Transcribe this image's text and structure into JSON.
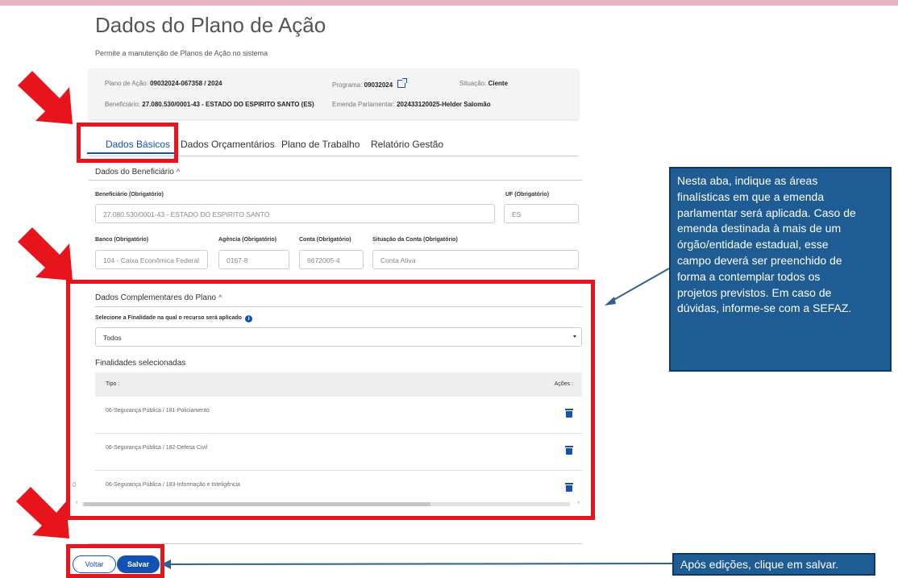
{
  "page": {
    "title": "Dados do Plano de Ação",
    "subtitle": "Permite a manutenção de Planos de Ação no sistema"
  },
  "info": {
    "plano_label": "Plano de Ação:",
    "plano_value": "09032024-067358 / 2024",
    "programa_label": "Programa:",
    "programa_value": "09032024",
    "situacao_label": "Situação:",
    "situacao_value": "Ciente",
    "beneficiario_label": "Beneficiário:",
    "beneficiario_value": "27.080.530/0001-43 - ESTADO DO ESPIRITO SANTO (ES)",
    "emenda_label": "Emenda Parlamentar:",
    "emenda_value": "202433120025-Helder Salomão"
  },
  "tabs": [
    {
      "label": "Dados Básicos",
      "active": true
    },
    {
      "label": "Dados Orçamentários",
      "active": false
    },
    {
      "label": "Plano de Trabalho",
      "active": false
    },
    {
      "label": "Relatório Gestão",
      "active": false
    }
  ],
  "beneficiario_section": {
    "title": "Dados do Beneficiário",
    "beneficiario_label": "Beneficiário (Obrigatório)",
    "beneficiario_value": "27.080.530/0001-43 - ESTADO DO ESPIRITO SANTO",
    "uf_label": "UF (Obrigatório)",
    "uf_value": "ES",
    "banco_label": "Banco (Obrigatório)",
    "banco_value": "104 - Caixa Econômica Federal",
    "agencia_label": "Agência (Obrigatório)",
    "agencia_value": "0167-8",
    "conta_label": "Conta (Obrigatório)",
    "conta_value": "6672005-4",
    "situacao_label": "Situação da Conta (Obrigatório)",
    "situacao_value": "Conta Ativa"
  },
  "complementares": {
    "title": "Dados Complementares do Plano",
    "select_label": "Selecione a Finalidade na qual o recurso será aplicado",
    "select_value": "Todos",
    "finalidades_title": "Finalidades selecionadas",
    "col_tipo": "Tipo :",
    "col_acoes": "Ações :",
    "rows": [
      "06-Segurança Pública / 181-Policiamento",
      "06-Segurança Pública / 182-Defesa Civil",
      "06-Segurança Pública / 183-Informação e Inteligência"
    ]
  },
  "buttons": {
    "voltar": "Voltar",
    "salvar": "Salvar"
  },
  "callouts": {
    "abas": [
      "Nesta aba, indique as áreas",
      "finalísticas em que a emenda",
      "parlamentar será aplicada. Caso de",
      "emenda destinada à mais de um",
      "órgão/entidade estadual, esse",
      "campo deverá ser preenchido de",
      "forma a contemplar todos os",
      "projetos previstos. Em caso de",
      "dúvidas, informe-se com a SEFAZ."
    ],
    "salvar": "Após edições, clique em salvar."
  },
  "misc": {
    "row_marker": "0"
  },
  "colors": {
    "primary": "#1351b4",
    "highlight_red": "#e8141b",
    "callout_bg": "#1f5c93",
    "topbar": "#e8b4c4"
  }
}
